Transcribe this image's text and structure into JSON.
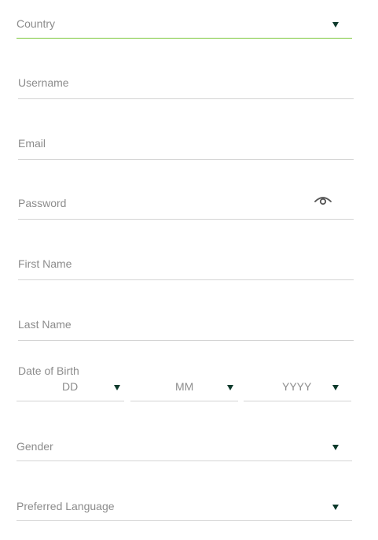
{
  "form": {
    "country": {
      "placeholder": "Country",
      "icon": "chevron-down-icon"
    },
    "username": {
      "placeholder": "Username"
    },
    "email": {
      "placeholder": "Email"
    },
    "password": {
      "placeholder": "Password",
      "toggle_icon": "eye-icon"
    },
    "first_name": {
      "placeholder": "First Name"
    },
    "last_name": {
      "placeholder": "Last Name"
    },
    "date_of_birth": {
      "label": "Date of Birth",
      "day_placeholder": "DD",
      "month_placeholder": "MM",
      "year_placeholder": "YYYY"
    },
    "gender": {
      "placeholder": "Gender",
      "icon": "chevron-down-icon"
    },
    "preferred_language": {
      "placeholder": "Preferred Language",
      "icon": "chevron-down-icon"
    }
  },
  "colors": {
    "active_underline": "#7cc73a",
    "underline": "#d4d4d4",
    "placeholder_text": "#8c8c8c",
    "dropdown_arrow": "#0e3a2c"
  }
}
